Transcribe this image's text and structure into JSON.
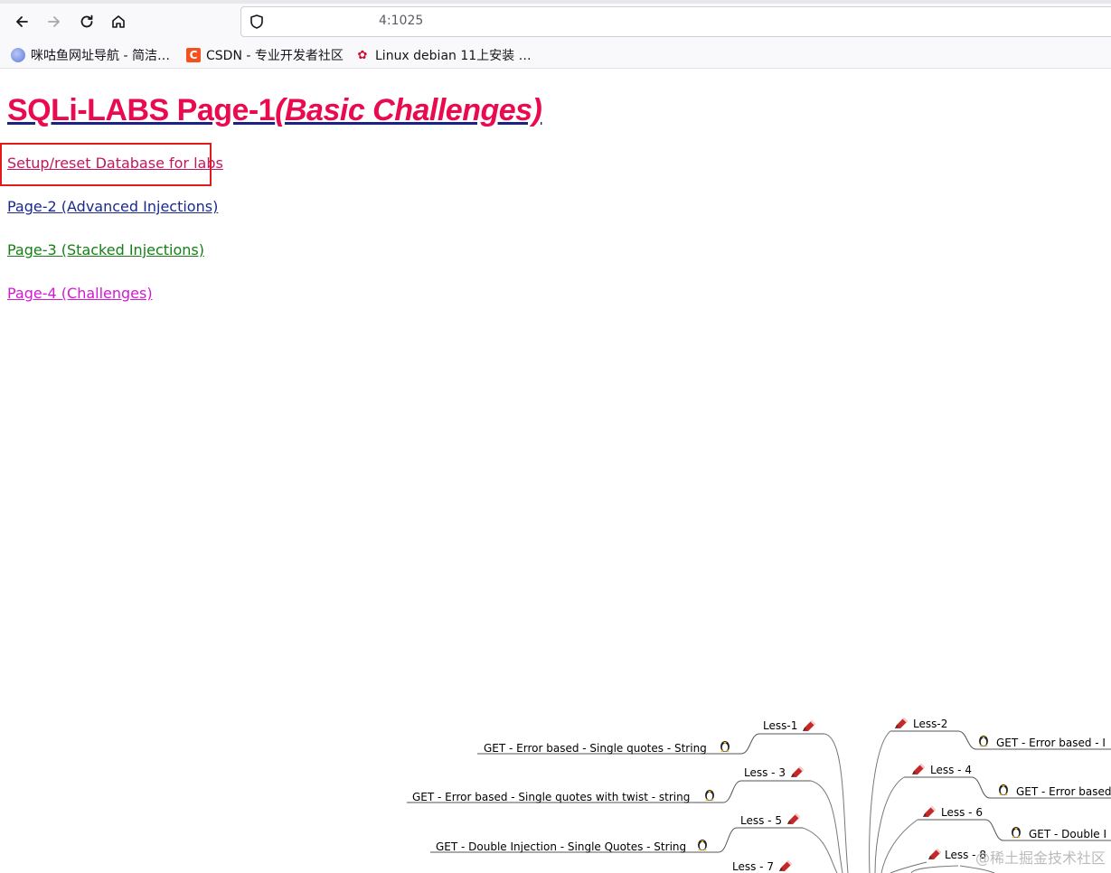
{
  "browser": {
    "url": "4:1025",
    "bookmarks": [
      {
        "label": "咪咕鱼网址导航 - 简洁…",
        "icon": "globe-icon"
      },
      {
        "label": "CSDN - 专业开发者社区",
        "icon": "csdn-icon"
      },
      {
        "label": "Linux debian 11上安装 …",
        "icon": "huawei-icon"
      }
    ]
  },
  "page": {
    "title_main": "SQLi-LABS Page-1",
    "title_sub": "(Basic Challenges)",
    "links": {
      "setup": "Setup/reset Database for labs",
      "page2": "Page-2 (Advanced Injections)",
      "page3": "Page-3 (Stacked Injections)",
      "page4": "Page-4 (Challenges)"
    }
  },
  "mindmap": {
    "left": [
      {
        "less": "Less-1",
        "desc": "GET - Error based - Single quotes - String"
      },
      {
        "less": "Less - 3",
        "desc": "GET - Error based - Single quotes with twist - string"
      },
      {
        "less": "Less - 5",
        "desc": "GET - Double Injection - Single Quotes - String"
      },
      {
        "less": "Less - 7"
      }
    ],
    "right": [
      {
        "less": "Less-2",
        "desc": "GET - Error based - I"
      },
      {
        "less": "Less - 4",
        "desc": "GET - Error based"
      },
      {
        "less": "Less - 6",
        "desc": "GET - Double I"
      },
      {
        "less": "Less - 8"
      }
    ]
  },
  "watermark": "@稀土掘金技术社区"
}
